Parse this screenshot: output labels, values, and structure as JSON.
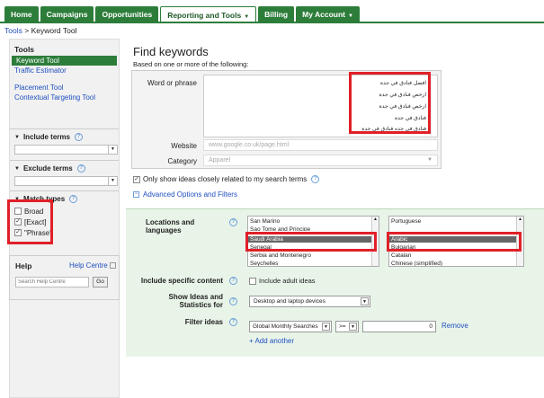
{
  "nav": {
    "tabs": [
      {
        "label": "Home",
        "caret": ""
      },
      {
        "label": "Campaigns",
        "caret": ""
      },
      {
        "label": "Opportunities",
        "caret": ""
      },
      {
        "label": "Reporting and Tools",
        "caret": "▼"
      },
      {
        "label": "Billing",
        "caret": ""
      },
      {
        "label": "My Account",
        "caret": "▼"
      }
    ],
    "active_tab": "Reporting and Tools"
  },
  "breadcrumb": {
    "link": "Tools",
    "sep": ">",
    "current": "Keyword Tool"
  },
  "sidebar": {
    "tools_title": "Tools",
    "items": [
      "Keyword Tool",
      "Traffic Estimator",
      "Placement Tool",
      "Contextual Targeting Tool"
    ],
    "include_terms": "Include terms",
    "exclude_terms": "Exclude terms",
    "match_types_title": "Match types",
    "match_types": [
      {
        "label": "Broad",
        "checked": false
      },
      {
        "label": "[Exact]",
        "checked": true
      },
      {
        "label": "\"Phrase\"",
        "checked": true
      }
    ]
  },
  "help": {
    "title": "Help",
    "centre_link": "Help Centre",
    "search_placeholder": "Search Help Centre",
    "go_label": "Go"
  },
  "main": {
    "title": "Find keywords",
    "subtitle": "Based on one or more of the following:",
    "word_label": "Word or phrase",
    "keywords": [
      "افضل فنادق في جدة",
      "ارخص فنادق في جدة",
      "ارخص فنادق في جدة",
      "فنادق في جدة",
      "فنادق في جده فنادق في جدة"
    ],
    "website_label": "Website",
    "website_placeholder": "www.google.co.uk/page.html",
    "category_label": "Category",
    "category_placeholder": "Apparel",
    "only_show": "Only show ideas closely related to my search terms",
    "advanced_link": "Advanced Options and Filters"
  },
  "advanced": {
    "locations_label": "Locations and languages",
    "locations": [
      "San Marino",
      "Sao Tome and Principe",
      "Saudi Arabia",
      "Senegal",
      "Serbia and Montenegro",
      "Seychelles"
    ],
    "selected_location": "Saudi Arabia",
    "languages": [
      "Portuguese",
      "Arabic",
      "Bulgarian",
      "Catalan",
      "Chinese (simplified)"
    ],
    "selected_language": "Arabic",
    "include_content_label": "Include specific content",
    "include_adult": "Include adult ideas",
    "show_ideas_label_1": "Show Ideas and",
    "show_ideas_label_2": "Statistics for",
    "devices_value": "Desktop and laptop devices",
    "filter_label": "Filter ideas",
    "filter_metric": "Global Monthly Searches",
    "filter_op": ">=",
    "filter_value": "0",
    "remove_label": "Remove",
    "add_another": "+ Add another"
  }
}
